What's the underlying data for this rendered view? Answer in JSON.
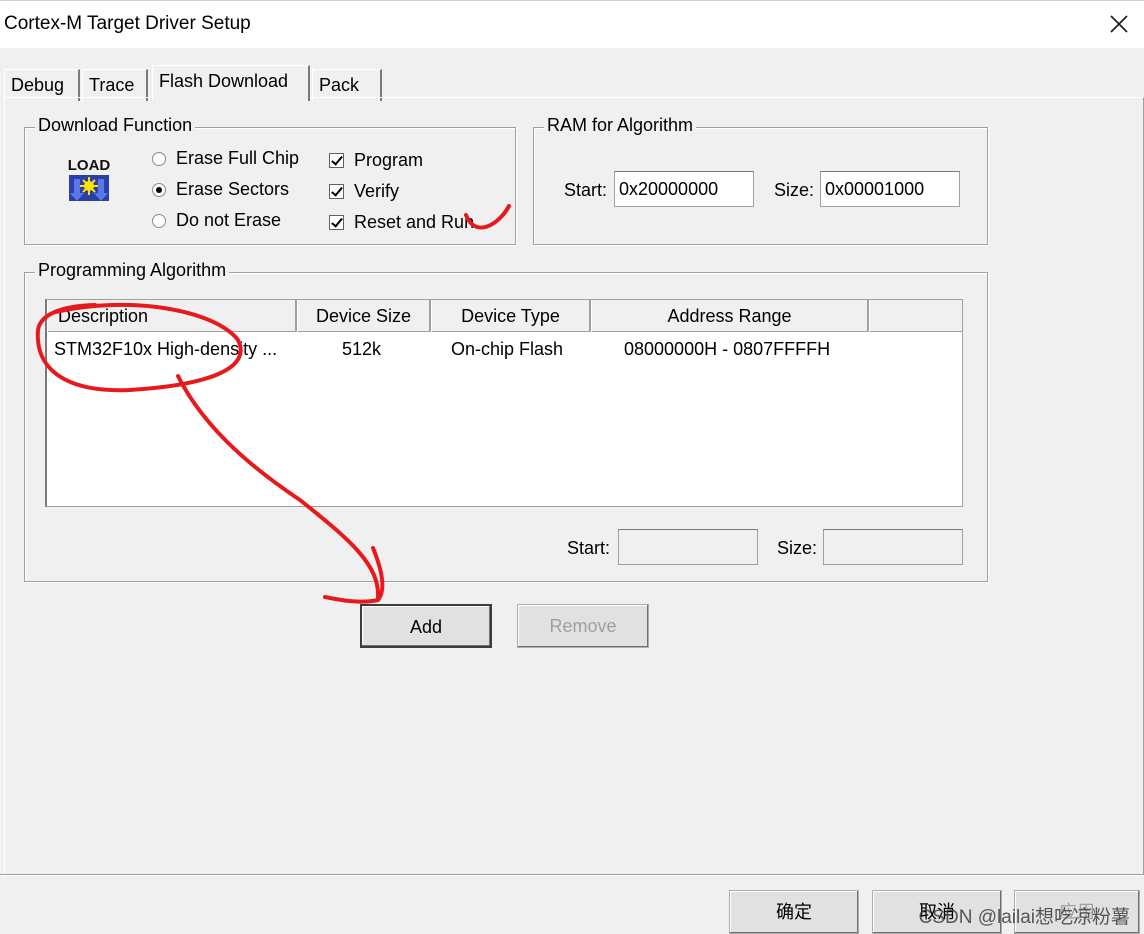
{
  "window": {
    "title": "Cortex-M Target Driver Setup"
  },
  "tabs": [
    {
      "label": "Debug"
    },
    {
      "label": "Trace"
    },
    {
      "label": "Flash Download"
    },
    {
      "label": "Pack"
    }
  ],
  "download_function": {
    "label": "Download Function",
    "icon_text": "LOAD",
    "erase_options": [
      {
        "label": "Erase Full Chip",
        "selected": false
      },
      {
        "label": "Erase Sectors",
        "selected": true
      },
      {
        "label": "Do not Erase",
        "selected": false
      }
    ],
    "checks": [
      {
        "label": "Program",
        "checked": true
      },
      {
        "label": "Verify",
        "checked": true
      },
      {
        "label": "Reset and Run",
        "checked": true
      }
    ]
  },
  "ram": {
    "label": "RAM for Algorithm",
    "start_label": "Start:",
    "start_value": "0x20000000",
    "size_label": "Size:",
    "size_value": "0x00001000"
  },
  "algorithm": {
    "label": "Programming Algorithm",
    "columns": [
      "Description",
      "Device Size",
      "Device Type",
      "Address Range"
    ],
    "rows": [
      {
        "description": "STM32F10x High-density ...",
        "size": "512k",
        "type": "On-chip Flash",
        "range": "08000000H - 0807FFFFH"
      }
    ],
    "start_label": "Start:",
    "start_value": "",
    "size_label": "Size:",
    "size_value": ""
  },
  "buttons": {
    "add": "Add",
    "remove": "Remove",
    "ok": "确定",
    "cancel": "取消",
    "apply": "应用"
  },
  "watermark": "CSDN @lailai想吃凉粉薯",
  "colors": {
    "annotation": "#e8191c",
    "background": "#f0f0f0"
  }
}
